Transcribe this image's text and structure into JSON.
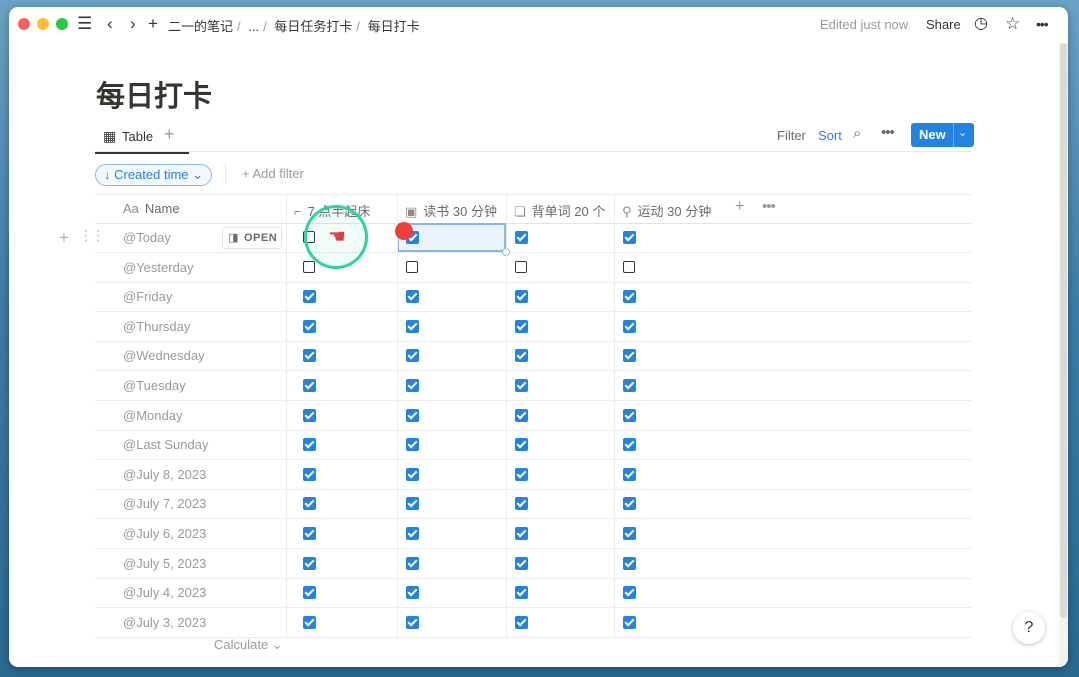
{
  "topbar": {
    "breadcrumbs": [
      "二一的笔记",
      "...",
      "每日任务打卡",
      "每日打卡"
    ],
    "edited": "Edited just now",
    "share": "Share"
  },
  "page": {
    "title": "每日打卡"
  },
  "view": {
    "tab_label": "Table",
    "filter": "Filter",
    "sort": "Sort",
    "new": "New",
    "sort_chip": "↓ Created time ⌄",
    "add_filter": "+ Add filter"
  },
  "columns": {
    "name": "Name",
    "name_icon": "Aa",
    "c1": "7 点半起床",
    "c2": "读书 30 分钟",
    "c3": "背单词 20 个",
    "c4": "运动 30 分钟"
  },
  "open_label": "OPEN",
  "rows": [
    {
      "name": "@Today",
      "checks": [
        false,
        true,
        true,
        true
      ]
    },
    {
      "name": "@Yesterday",
      "checks": [
        false,
        false,
        false,
        false
      ]
    },
    {
      "name": "@Friday",
      "checks": [
        true,
        true,
        true,
        true
      ]
    },
    {
      "name": "@Thursday",
      "checks": [
        true,
        true,
        true,
        true
      ]
    },
    {
      "name": "@Wednesday",
      "checks": [
        true,
        true,
        true,
        true
      ]
    },
    {
      "name": "@Tuesday",
      "checks": [
        true,
        true,
        true,
        true
      ]
    },
    {
      "name": "@Monday",
      "checks": [
        true,
        true,
        true,
        true
      ]
    },
    {
      "name": "@Last Sunday",
      "checks": [
        true,
        true,
        true,
        true
      ]
    },
    {
      "name": "@July 8, 2023",
      "checks": [
        true,
        true,
        true,
        true
      ]
    },
    {
      "name": "@July 7, 2023",
      "checks": [
        true,
        true,
        true,
        true
      ]
    },
    {
      "name": "@July 6, 2023",
      "checks": [
        true,
        true,
        true,
        true
      ]
    },
    {
      "name": "@July 5, 2023",
      "checks": [
        true,
        true,
        true,
        true
      ]
    },
    {
      "name": "@July 4, 2023",
      "checks": [
        true,
        true,
        true,
        true
      ]
    },
    {
      "name": "@July 3, 2023",
      "checks": [
        true,
        true,
        true,
        true
      ]
    }
  ],
  "calculate": "Calculate ⌄",
  "help": "?",
  "colors": {
    "accent": "#2383e2",
    "text": "#37352f",
    "muted": "#9b9a97",
    "click_ring": "#2dd4a0"
  }
}
